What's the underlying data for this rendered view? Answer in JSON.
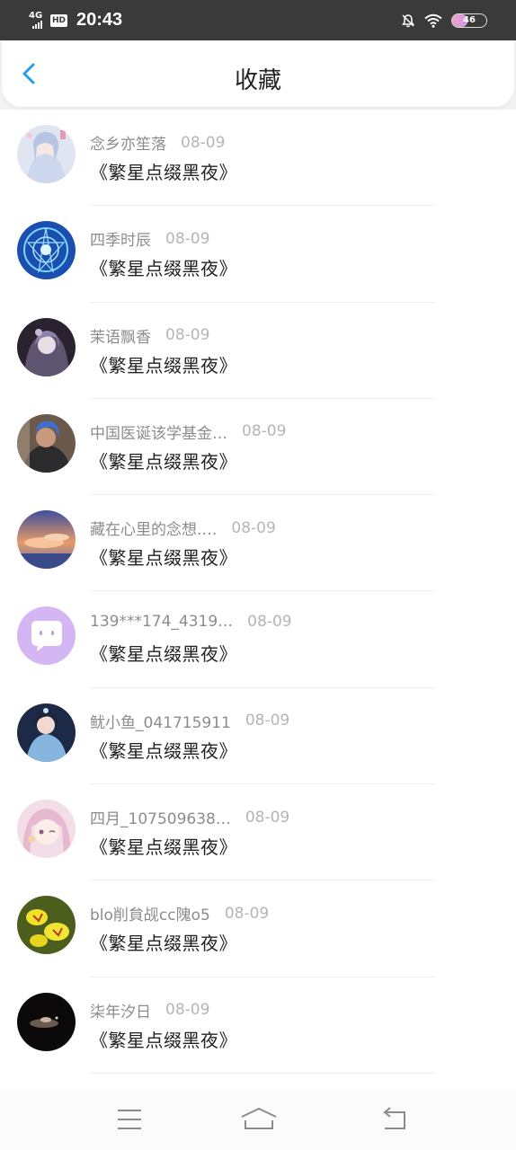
{
  "status_bar": {
    "network": "4G",
    "hd_label": "HD",
    "time": "20:43",
    "battery_level": "46",
    "battery_fraction": 0.46
  },
  "header": {
    "title": "收藏",
    "back_icon": "chevron-left-icon",
    "accent_color": "#2a9be8"
  },
  "items": [
    {
      "user": "念乡亦笙落",
      "date": "08-09",
      "content": "《繁星点缀黑夜》"
    },
    {
      "user": "四季时辰",
      "date": "08-09",
      "content": "《繁星点缀黑夜》"
    },
    {
      "user": "茉语飘香",
      "date": "08-09",
      "content": "《繁星点缀黑夜》"
    },
    {
      "user": "中国医诞该学基金…",
      "date": "08-09",
      "content": "《繁星点缀黑夜》"
    },
    {
      "user": "藏在心里的念想.…",
      "date": "08-09",
      "content": "《繁星点缀黑夜》"
    },
    {
      "user": "139***174_4319…",
      "date": "08-09",
      "content": "《繁星点缀黑夜》"
    },
    {
      "user": "鱿小鱼_041715911",
      "date": "08-09",
      "content": "《繁星点缀黑夜》"
    },
    {
      "user": "四月_107509638…",
      "date": "08-09",
      "content": "《繁星点缀黑夜》"
    },
    {
      "user": "blo削貟觇cc隗o5",
      "date": "08-09",
      "content": "《繁星点缀黑夜》"
    },
    {
      "user": "柒年汐日",
      "date": "08-09",
      "content": "《繁星点缀黑夜》"
    }
  ],
  "nav_bar": {
    "menu_icon": "menu-icon",
    "home_icon": "home-icon",
    "back_icon": "back-icon"
  }
}
